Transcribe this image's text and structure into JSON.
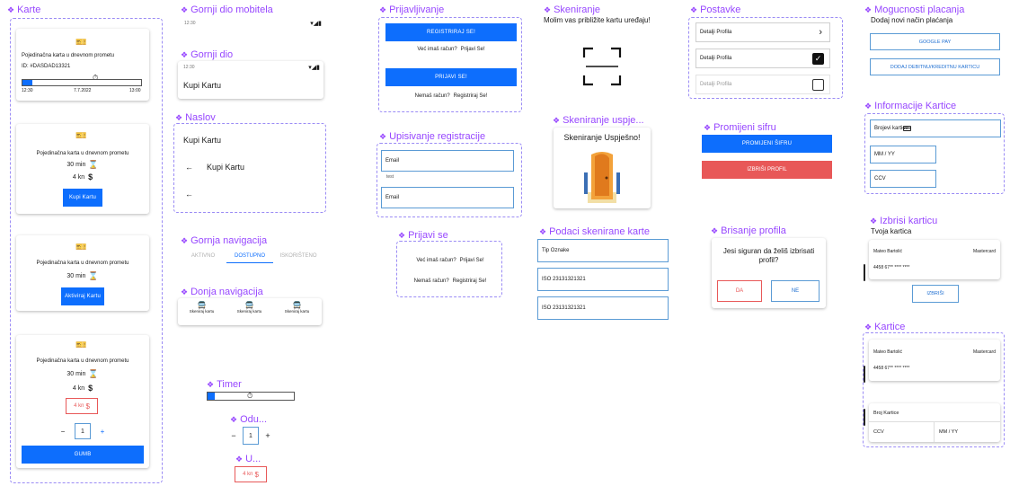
{
  "titles": {
    "karte": "Karte",
    "gornji_mob": "Gornji dio mobitela",
    "gornji": "Gornji dio",
    "naslov": "Naslov",
    "gornja_nav": "Gornja navigacija",
    "donja_nav": "Donja navigacija",
    "timer": "Timer",
    "odu": "Odu...",
    "u": "U...",
    "prijavljivanje": "Prijavljivanje",
    "upisivanje": "Upisivanje registracije",
    "prijavi_se": "Prijavi se",
    "skeniranje": "Skeniranje",
    "skeniranje_uspje": "Skeniranje uspje...",
    "podaci": "Podaci skenirane karte",
    "postavke": "Postavke",
    "promijeni": "Promijeni sifru",
    "brisanje": "Brisanje profila",
    "mogucnosti": "Mogucnosti placanja",
    "info_kartice": "Informacije Kartice",
    "izbrisi_karticu": "Izbrisi karticu",
    "kartice": "Kartice"
  },
  "karte": {
    "card1": {
      "title": "Pojedinačna karta u dnevnom prometu",
      "id": "ID: #DASDAD13321",
      "time_start": "12:30",
      "date": "7.7.2022",
      "time_end": "13:00",
      "progress": 0.08
    },
    "card2": {
      "title": "Pojedinačna karta u dnevnom prometu",
      "duration": "30 min",
      "price": "4 kn",
      "button": "Kupi Kartu"
    },
    "card3": {
      "title": "Pojedinačna karta u dnevnom prometu",
      "duration": "30 min",
      "button": "Aktiviraj Kartu"
    },
    "card4": {
      "title": "Pojedinačna karta u dnevnom prometu",
      "duration": "30 min",
      "price": "4 kn",
      "price_box": "4 kn",
      "qty": "1",
      "minus": "−",
      "plus": "+",
      "button": "GUMB"
    }
  },
  "status_bar": {
    "time": "12:30"
  },
  "gornji_dio": {
    "time": "12:30",
    "title": "Kupi Kartu"
  },
  "naslov": {
    "row1": "Kupi Kartu",
    "row2": "Kupi Kartu",
    "arrow": "←"
  },
  "top_nav": {
    "tabs": [
      "AKTIVNO",
      "DOSTUPNO",
      "ISKORIŠTENO"
    ],
    "active": 1
  },
  "bottom_nav": {
    "items": [
      "Skeniraj kartu",
      "Skeniraj kartu",
      "Skeniraj kartu"
    ]
  },
  "timer": {
    "progress": 0.08
  },
  "odu": {
    "minus": "−",
    "value": "1",
    "plus": "+"
  },
  "u_price": "4 kn",
  "prijavljivanje": {
    "register_btn": "REGISTRIRAJ SE!",
    "have_account": "Već imaš račun?",
    "login_link": "Prijavi Se!",
    "login_btn": "PRIJAVI SE!",
    "no_account": "Nemaš račun?",
    "register_link": "Registriraj Se!"
  },
  "upisivanje": {
    "email_label": "Email",
    "email_value": "test",
    "email2_label": "Email"
  },
  "prijavi_se": {
    "have_account": "Već imaš račun?",
    "login_link": "Prijavi Se!",
    "no_account": "Nemaš račun?",
    "register_link": "Registriraj Se!"
  },
  "skeniranje": {
    "instruction": "Molim vas približite kartu uređaju!"
  },
  "skeniranje_uspjesno": {
    "text": "Skeniranje Uspješno!"
  },
  "podaci": {
    "rows": [
      "Tip Oznake",
      "ISO 23131321321",
      "ISO 23131321321"
    ]
  },
  "postavke": {
    "rows": [
      "Detalji Profila",
      "Detalji Profila",
      "Detalji Profila"
    ]
  },
  "promijeni": {
    "change_btn": "PROMIJENI ŠIFRU",
    "delete_btn": "IZBRIŠI PROFIL"
  },
  "brisanje": {
    "question": "Jesi siguran da želiš izbrisati profil?",
    "yes": "DA",
    "no": "NE"
  },
  "mogucnosti": {
    "subtitle": "Dodaj novi način plaćanja",
    "google_pay": "GOOGLE PAY",
    "add_card": "DODAJ DEBITNU/KREDITNU KARTICU"
  },
  "info_kartice": {
    "number": "Brojevi kartice",
    "mmyy": "MM / YY",
    "ccv": "CCV"
  },
  "izbrisi": {
    "subtitle": "Tvoja kartica",
    "name": "Mateo Bartolić",
    "brand": "Mastercard",
    "number": "4458 67** **** ****",
    "button": "IZBRIŠI"
  },
  "kartice": {
    "name": "Mateo Bartolić",
    "brand": "Mastercard",
    "number": "4458 67** **** ****",
    "new_number": "Broj Kartice",
    "ccv": "CCV",
    "mmyy": "MM / YY"
  },
  "colors": {
    "accent": "#0d6efd",
    "danger": "#e85858",
    "frame": "#9747ff"
  }
}
